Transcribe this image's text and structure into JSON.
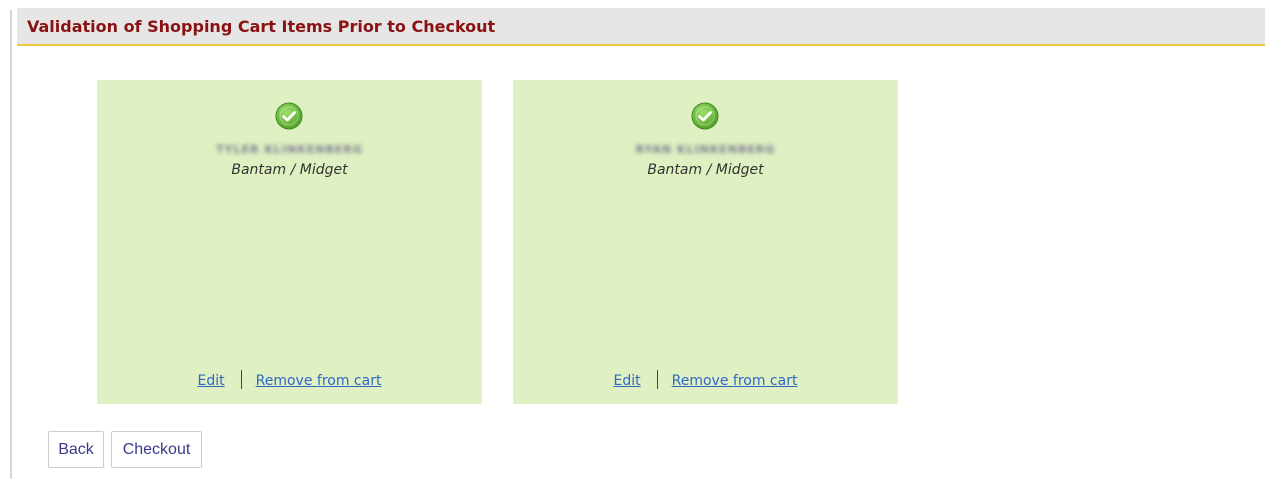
{
  "header": {
    "title": "Validation of Shopping Cart Items Prior to Checkout"
  },
  "cart_items": [
    {
      "status_icon": "check-circle-icon",
      "name": "TYLER KLINKENBERG",
      "division": "Bantam / Midget",
      "edit_label": "Edit",
      "remove_label": "Remove from cart"
    },
    {
      "status_icon": "check-circle-icon",
      "name": "RYAN KLINKENBERG",
      "division": "Bantam / Midget",
      "edit_label": "Edit",
      "remove_label": "Remove from cart"
    }
  ],
  "buttons": {
    "back_label": "Back",
    "checkout_label": "Checkout"
  },
  "colors": {
    "header_title": "#8a1212",
    "header_underline": "#f0c63c",
    "card_background": "#dff0c2",
    "link": "#2f67c8",
    "check_green": "#5fb234"
  }
}
